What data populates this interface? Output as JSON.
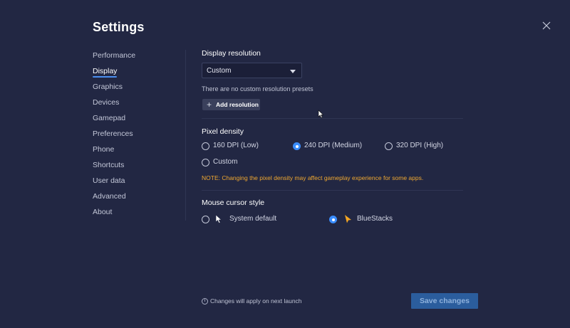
{
  "window": {
    "title": "Settings"
  },
  "nav": {
    "items": [
      {
        "label": "Performance"
      },
      {
        "label": "Display",
        "active": true
      },
      {
        "label": "Graphics"
      },
      {
        "label": "Devices"
      },
      {
        "label": "Gamepad"
      },
      {
        "label": "Preferences"
      },
      {
        "label": "Phone"
      },
      {
        "label": "Shortcuts"
      },
      {
        "label": "User data"
      },
      {
        "label": "Advanced"
      },
      {
        "label": "About"
      }
    ]
  },
  "display_resolution": {
    "title": "Display resolution",
    "selected": "Custom",
    "hint": "There are no custom resolution presets",
    "add_button": "Add resolution"
  },
  "pixel_density": {
    "title": "Pixel density",
    "options": [
      {
        "label": "160 DPI (Low)",
        "checked": false
      },
      {
        "label": "240 DPI (Medium)",
        "checked": true
      },
      {
        "label": "320 DPI (High)",
        "checked": false
      },
      {
        "label": "Custom",
        "checked": false
      }
    ],
    "note": "NOTE: Changing the pixel density may affect gameplay experience for some apps."
  },
  "mouse_cursor": {
    "title": "Mouse cursor style",
    "options": [
      {
        "label": "System default",
        "checked": false,
        "icon": "white-arrow-cursor-icon"
      },
      {
        "label": "BlueStacks",
        "checked": true,
        "icon": "orange-arrow-cursor-icon"
      }
    ]
  },
  "footer": {
    "info_text": "Changes will apply on next launch",
    "info_icon": "i",
    "save_label": "Save changes"
  },
  "colors": {
    "background": "#222743",
    "accent": "#3a8dff",
    "warning": "#f0a830",
    "save_button": "#2b5d9d"
  }
}
